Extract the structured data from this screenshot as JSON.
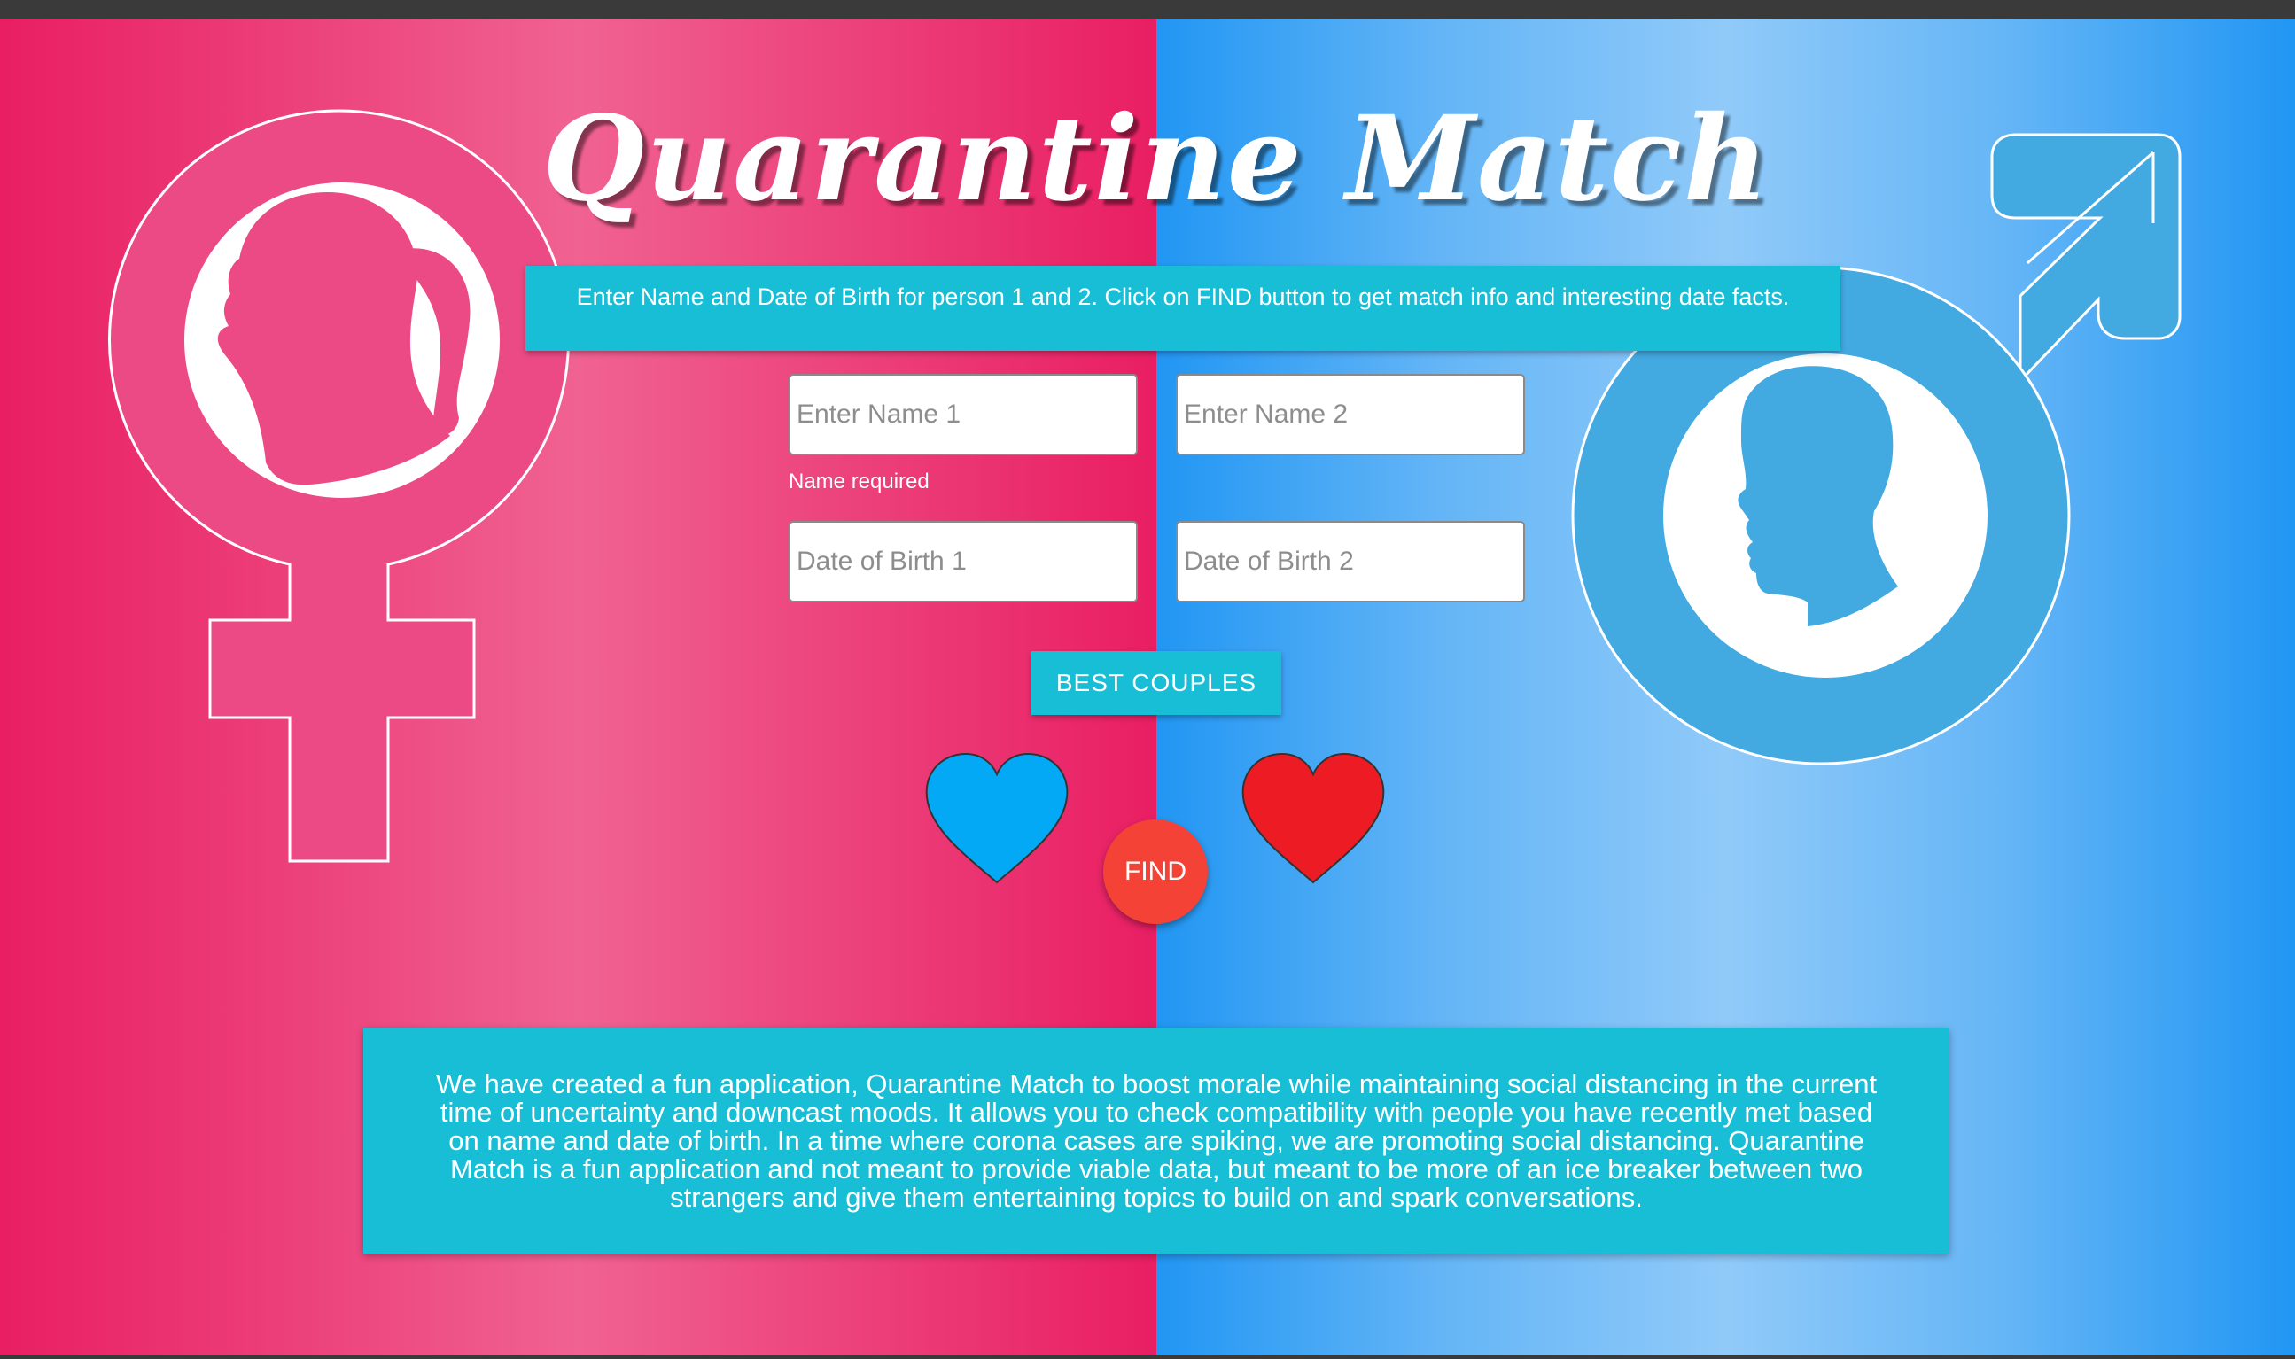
{
  "app": {
    "title": "Quarantine Match",
    "instructions": "Enter Name and Date of Birth for person 1 and 2. Click on FIND button to get match info and interesting date facts."
  },
  "form": {
    "name1_placeholder": "Enter Name 1",
    "name1_value": "",
    "name2_placeholder": "Enter Name 2",
    "name2_value": "",
    "name_error": "Name required",
    "dob1_placeholder": "Date of Birth 1",
    "dob1_value": "",
    "dob2_placeholder": "Date of Birth 2",
    "dob2_value": ""
  },
  "buttons": {
    "best_couples": "BEST COUPLES",
    "find": "FIND"
  },
  "about": {
    "text": "We have created a fun application, Quarantine Match to boost morale while maintaining social distancing in the current time of uncertainty and downcast moods. It allows you to check compatibility with people you have recently met based on name and date of birth. In a time where corona cases are spiking, we are promoting social distancing. Quarantine Match is a fun application and not meant to provide viable data, but meant to be more of an ice breaker between two strangers and give them entertaining topics to build on and spark conversations."
  },
  "icons": {
    "female_symbol": "female-symbol-icon",
    "male_symbol": "male-symbol-icon",
    "heart_left": "heart-icon-blue",
    "heart_right": "heart-icon-red"
  },
  "colors": {
    "pink_primary": "#e91e63",
    "blue_primary": "#2196f3",
    "cyan_accent": "#17bed6",
    "find_red": "#f44336",
    "heart_blue": "#03a9f4",
    "heart_red": "#ed1c24",
    "female_symbol_fill": "#ec4a84",
    "male_symbol_fill": "#42a8e0"
  }
}
